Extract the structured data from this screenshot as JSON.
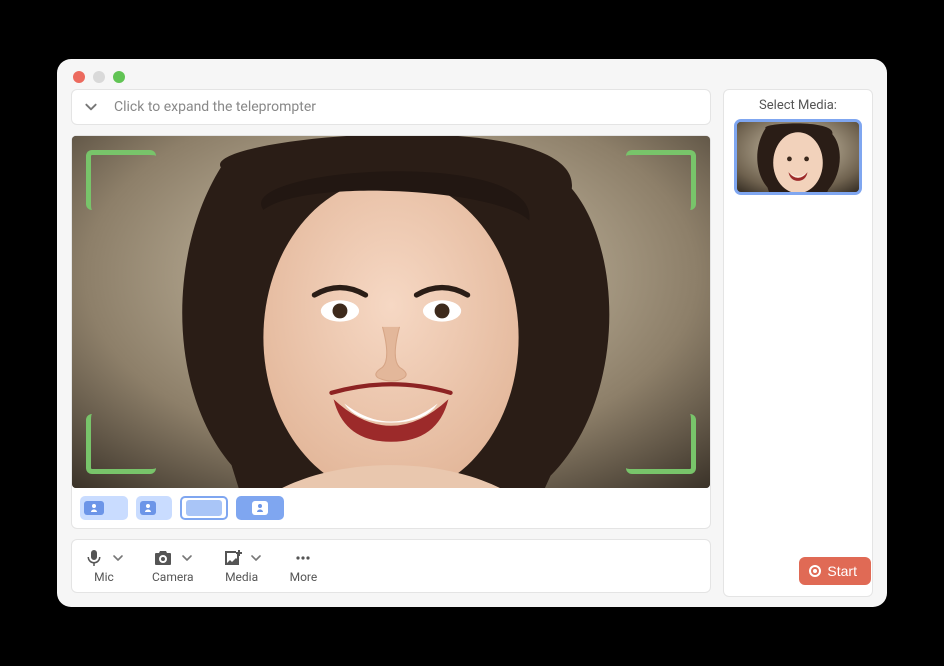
{
  "teleprompter": {
    "placeholder": "Click to expand the teleprompter"
  },
  "sidebar": {
    "title": "Select Media:"
  },
  "toolbar": {
    "mic": "Mic",
    "camera": "Camera",
    "media": "Media",
    "more": "More"
  },
  "start": {
    "label": "Start"
  },
  "colors": {
    "accent_blue": "#7fa6f0",
    "frame_green": "#78c46a",
    "start_red": "#e06a55"
  }
}
